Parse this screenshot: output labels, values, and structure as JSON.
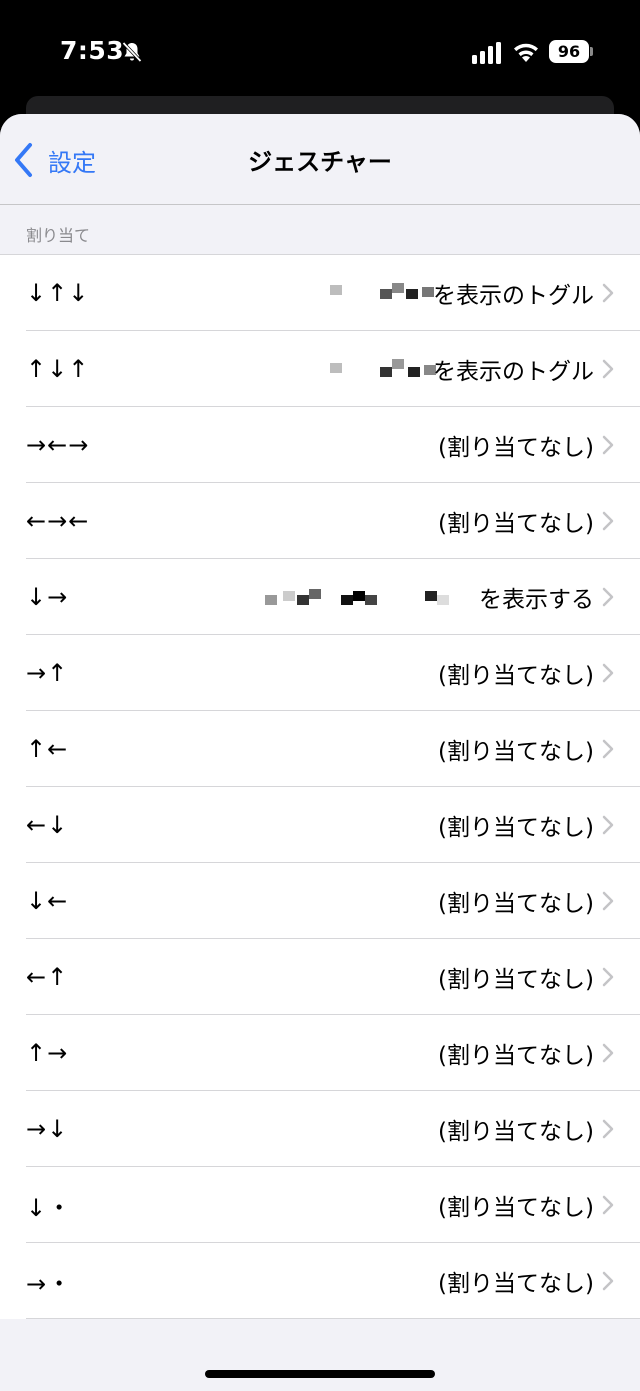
{
  "status_bar": {
    "time": "7:53",
    "battery": "96"
  },
  "nav": {
    "back_label": "設定",
    "title": "ジェスチャー"
  },
  "section_header": "割り当て",
  "rows": [
    {
      "gesture": "↓↑↓",
      "value": "を表示のトグル"
    },
    {
      "gesture": "↑↓↑",
      "value": "を表示のトグル"
    },
    {
      "gesture": "→←→",
      "value": "(割り当てなし)"
    },
    {
      "gesture": "←→←",
      "value": "(割り当てなし)"
    },
    {
      "gesture": "↓→",
      "value": "を表示する"
    },
    {
      "gesture": "→↑",
      "value": "(割り当てなし)"
    },
    {
      "gesture": "↑←",
      "value": "(割り当てなし)"
    },
    {
      "gesture": "←↓",
      "value": "(割り当てなし)"
    },
    {
      "gesture": "↓←",
      "value": "(割り当てなし)"
    },
    {
      "gesture": "←↑",
      "value": "(割り当てなし)"
    },
    {
      "gesture": "↑→",
      "value": "(割り当てなし)"
    },
    {
      "gesture": "→↓",
      "value": "(割り当てなし)"
    },
    {
      "gesture": "↓・",
      "value": "(割り当てなし)"
    },
    {
      "gesture": "→・",
      "value": "(割り当てなし)"
    }
  ],
  "colors": {
    "accent": "#3478f6",
    "background": "#f2f2f7",
    "separator": "#d6d6d9"
  }
}
